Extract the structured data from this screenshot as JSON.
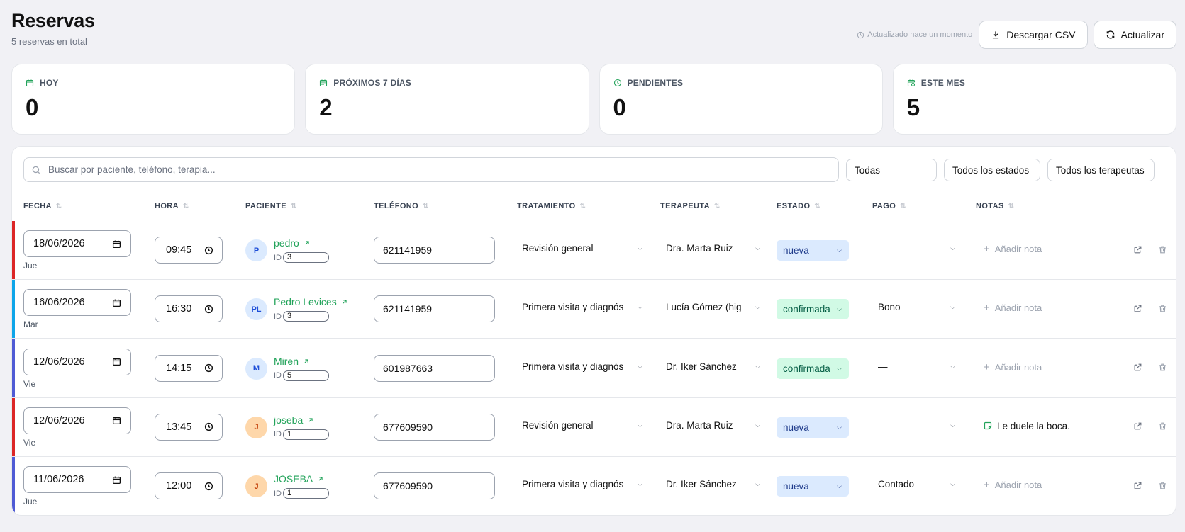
{
  "header": {
    "title": "Reservas",
    "subtitle": "5 reservas en total",
    "updated": "Actualizado hace un momento",
    "download_label": "Descargar CSV",
    "refresh_label": "Actualizar"
  },
  "stats": [
    {
      "label": "HOY",
      "value": "0",
      "icon": "calendar-icon"
    },
    {
      "label": "PRÓXIMOS 7 DÍAS",
      "value": "2",
      "icon": "calendar-range-icon"
    },
    {
      "label": "PENDIENTES",
      "value": "0",
      "icon": "clock-icon"
    },
    {
      "label": "ESTE MES",
      "value": "5",
      "icon": "calendar-clock-icon"
    }
  ],
  "filters": {
    "search_placeholder": "Buscar por paciente, teléfono, terapia...",
    "period": "Todas",
    "state": "Todos los estados",
    "therapist": "Todos los terapeutas"
  },
  "columns": [
    "FECHA",
    "HORA",
    "PACIENTE",
    "TELÉFONO",
    "TRATAMIENTO",
    "TERAPEUTA",
    "ESTADO",
    "PAGO",
    "NOTAS"
  ],
  "rows": [
    {
      "date": "18/06/2026",
      "weekday": "Jue",
      "time": "09:45",
      "initials": "P",
      "name": "pedro",
      "id_label": "ID",
      "id": "3",
      "phone": "621141959",
      "treatment": "Revisión general",
      "therapist": "Dra. Marta Ruiz",
      "status": "nueva",
      "payment": "—",
      "note": "Añadir nota",
      "bar_color": "#dc2626",
      "avatar_color": "blue",
      "has_note": false
    },
    {
      "date": "16/06/2026",
      "weekday": "Mar",
      "time": "16:30",
      "initials": "PL",
      "name": "Pedro Levices",
      "id_label": "ID",
      "id": "3",
      "phone": "621141959",
      "treatment": "Primera visita y diagnós",
      "therapist": "Lucía Gómez (hig",
      "status": "confirmada",
      "payment": "Bono",
      "note": "Añadir nota",
      "bar_color": "#0ea5e9",
      "avatar_color": "blue",
      "has_note": false
    },
    {
      "date": "12/06/2026",
      "weekday": "Vie",
      "time": "14:15",
      "initials": "M",
      "name": "Miren",
      "id_label": "ID",
      "id": "5",
      "phone": "601987663",
      "treatment": "Primera visita y diagnós",
      "therapist": "Dr. Iker Sánchez",
      "status": "confirmada",
      "payment": "—",
      "note": "Añadir nota",
      "bar_color": "#4f5bd5",
      "avatar_color": "blue",
      "has_note": false
    },
    {
      "date": "12/06/2026",
      "weekday": "Vie",
      "time": "13:45",
      "initials": "J",
      "name": "joseba",
      "id_label": "ID",
      "id": "1",
      "phone": "677609590",
      "treatment": "Revisión general",
      "therapist": "Dra. Marta Ruiz",
      "status": "nueva",
      "payment": "—",
      "note": "Le duele la boca.",
      "bar_color": "#dc2626",
      "avatar_color": "orange",
      "has_note": true
    },
    {
      "date": "11/06/2026",
      "weekday": "Jue",
      "time": "12:00",
      "initials": "J",
      "name": "JOSEBA",
      "id_label": "ID",
      "id": "1",
      "phone": "677609590",
      "treatment": "Primera visita y diagnós",
      "therapist": "Dr. Iker Sánchez",
      "status": "nueva",
      "payment": "Contado",
      "note": "Añadir nota",
      "bar_color": "#4f5bd5",
      "avatar_color": "orange",
      "has_note": false
    }
  ]
}
